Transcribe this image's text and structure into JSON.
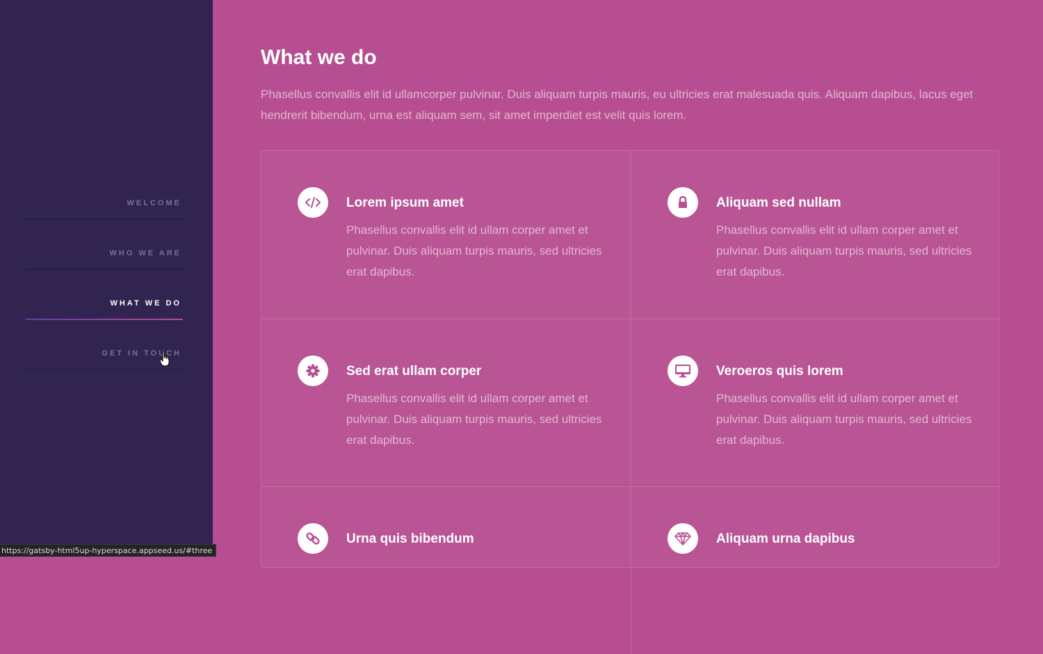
{
  "sidebar": {
    "nav": [
      {
        "label": "Welcome",
        "active": false
      },
      {
        "label": "Who we are",
        "active": false
      },
      {
        "label": "What we do",
        "active": true
      },
      {
        "label": "Get in touch",
        "active": false
      }
    ]
  },
  "section": {
    "title": "What we do",
    "intro": "Phasellus convallis elit id ullamcorper pulvinar. Duis aliquam turpis mauris, eu ultricies erat malesuada quis. Aliquam dapibus, lacus eget hendrerit bibendum, urna est aliquam sem, sit amet imperdiet est velit quis lorem.",
    "features": [
      {
        "icon": "code-icon",
        "title": "Lorem ipsum amet",
        "text": "Phasellus convallis elit id ullam corper amet et pulvinar. Duis aliquam turpis mauris, sed ultricies erat dapibus."
      },
      {
        "icon": "lock-icon",
        "title": "Aliquam sed nullam",
        "text": "Phasellus convallis elit id ullam corper amet et pulvinar. Duis aliquam turpis mauris, sed ultricies erat dapibus."
      },
      {
        "icon": "gear-icon",
        "title": "Sed erat ullam corper",
        "text": "Phasellus convallis elit id ullam corper amet et pulvinar. Duis aliquam turpis mauris, sed ultricies erat dapibus."
      },
      {
        "icon": "desktop-icon",
        "title": "Veroeros quis lorem",
        "text": "Phasellus convallis elit id ullam corper amet et pulvinar. Duis aliquam turpis mauris, sed ultricies erat dapibus."
      },
      {
        "icon": "link-icon",
        "title": "Urna quis bibendum",
        "text": ""
      },
      {
        "icon": "diamond-icon",
        "title": "Aliquam urna dapibus",
        "text": ""
      }
    ]
  },
  "status_bar": {
    "url": "https://gatsby-html5up-hyperspace.appseed.us/#three"
  },
  "colors": {
    "sidebar_bg": "#312450",
    "main_bg": "#b74e91",
    "icon_fg": "#b74e91",
    "active_line_start": "#5e42a6"
  }
}
